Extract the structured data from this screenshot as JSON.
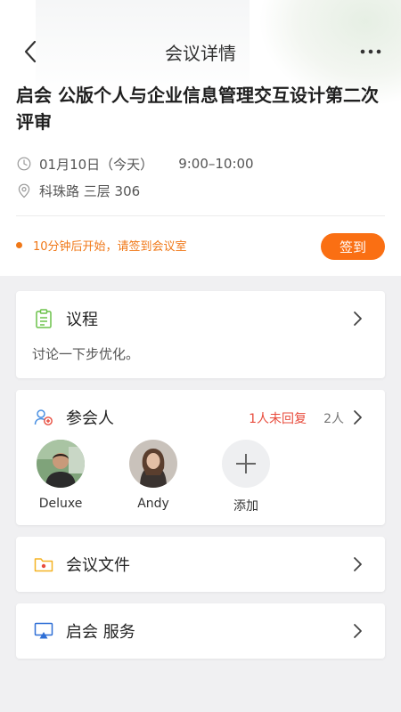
{
  "nav": {
    "title": "会议详情"
  },
  "meeting": {
    "title": "启会 公版个人与企业信息管理交互设计第二次评审",
    "date": "01月10日（今天）",
    "time": "9:00–10:00",
    "location": "科珠路 三层 306"
  },
  "notice": {
    "text": "10分钟后开始，请签到会议室",
    "signin_label": "签到"
  },
  "agenda": {
    "title": "议程",
    "content": "讨论一下步优化。"
  },
  "attendees": {
    "title": "参会人",
    "unreplied": "1人未回复",
    "count": "2人",
    "people": [
      {
        "name": "Deluxe"
      },
      {
        "name": "Andy"
      }
    ],
    "add_label": "添加"
  },
  "files": {
    "title": "会议文件"
  },
  "service": {
    "title": "启会 服务"
  },
  "colors": {
    "accent": "#fa6f13",
    "warning_text": "#f07818",
    "alert_red": "#e84c3d",
    "agenda_icon": "#6cc24a",
    "attendee_icon": "#4a90e2",
    "file_icon": "#f5b324",
    "service_icon": "#2f6fd6"
  },
  "icons": {
    "back": "chevron-left-icon",
    "more": "more-dots-icon",
    "clock": "clock-icon",
    "location": "location-pin-icon",
    "agenda": "clipboard-icon",
    "attendees": "people-icon",
    "files": "folder-icon",
    "service": "screen-icon",
    "add": "plus-icon"
  }
}
